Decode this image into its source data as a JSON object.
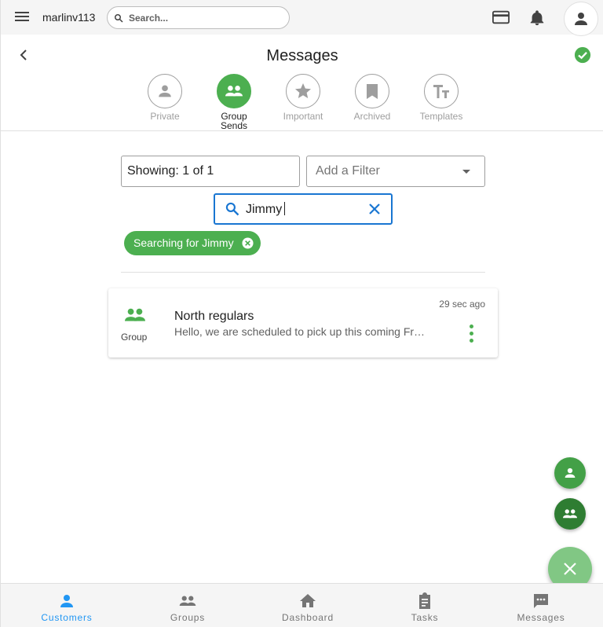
{
  "topbar": {
    "username": "marlinv113",
    "search_placeholder": "Search..."
  },
  "header": {
    "title": "Messages"
  },
  "tabs": [
    {
      "label": "Private",
      "icon": "person-icon",
      "active": false
    },
    {
      "label": "Group Sends",
      "icon": "group-icon",
      "active": true
    },
    {
      "label": "Important",
      "icon": "star-icon",
      "active": false
    },
    {
      "label": "Archived",
      "icon": "bookmark-icon",
      "active": false
    },
    {
      "label": "Templates",
      "icon": "text-format-icon",
      "active": false
    }
  ],
  "filters": {
    "showing": "Showing: 1 of 1",
    "add_filter": "Add a Filter",
    "search_value": "Jimmy",
    "chip_label": "Searching for Jimmy"
  },
  "messages": [
    {
      "type": "Group",
      "title": "North regulars",
      "preview": "Hello, we are scheduled to pick up this coming Friday",
      "time": "29 sec ago"
    }
  ],
  "bottom_nav": [
    {
      "label": "Customers",
      "icon": "person-icon",
      "active": true
    },
    {
      "label": "Groups",
      "icon": "group-icon",
      "active": false
    },
    {
      "label": "Dashboard",
      "icon": "home-icon",
      "active": false
    },
    {
      "label": "Tasks",
      "icon": "clipboard-icon",
      "active": false
    },
    {
      "label": "Messages",
      "icon": "chat-icon",
      "active": false
    }
  ],
  "colors": {
    "primary_green": "#4caf50",
    "dark_green": "#2e7d32",
    "focus_blue": "#1976d2",
    "nav_active": "#2196f3"
  }
}
